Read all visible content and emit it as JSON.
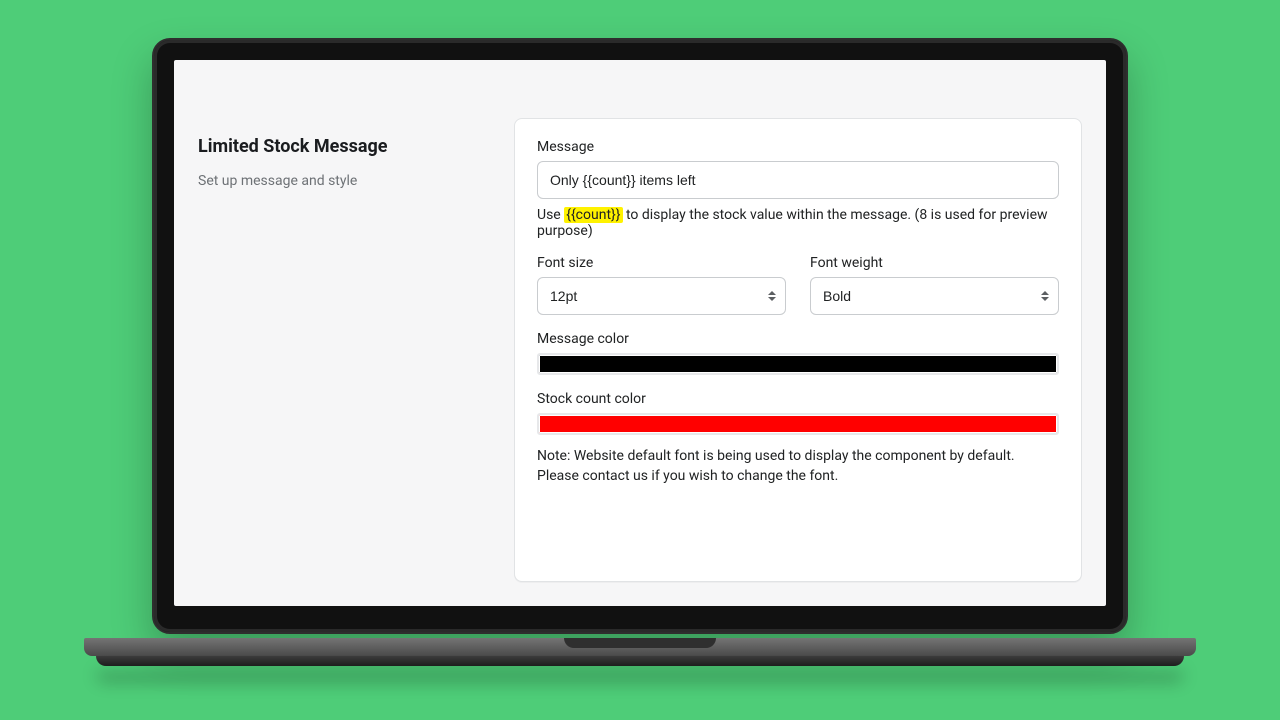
{
  "sidebar": {
    "title": "Limited Stock Message",
    "subtitle": "Set up message and style"
  },
  "form": {
    "message_label": "Message",
    "message_value": "Only {{count}} items left",
    "message_help_prefix": "Use ",
    "message_help_tag": "{{count}}",
    "message_help_suffix": " to display the stock value within the message. (8 is used for preview purpose)",
    "font_size_label": "Font size",
    "font_size_value": "12pt",
    "font_weight_label": "Font weight",
    "font_weight_value": "Bold",
    "message_color_label": "Message color",
    "message_color_value": "#000000",
    "stock_count_color_label": "Stock count color",
    "stock_count_color_value": "#ff0000",
    "note": "Note: Website default font is being used to display the component by default. Please contact us if you wish to change the font."
  }
}
